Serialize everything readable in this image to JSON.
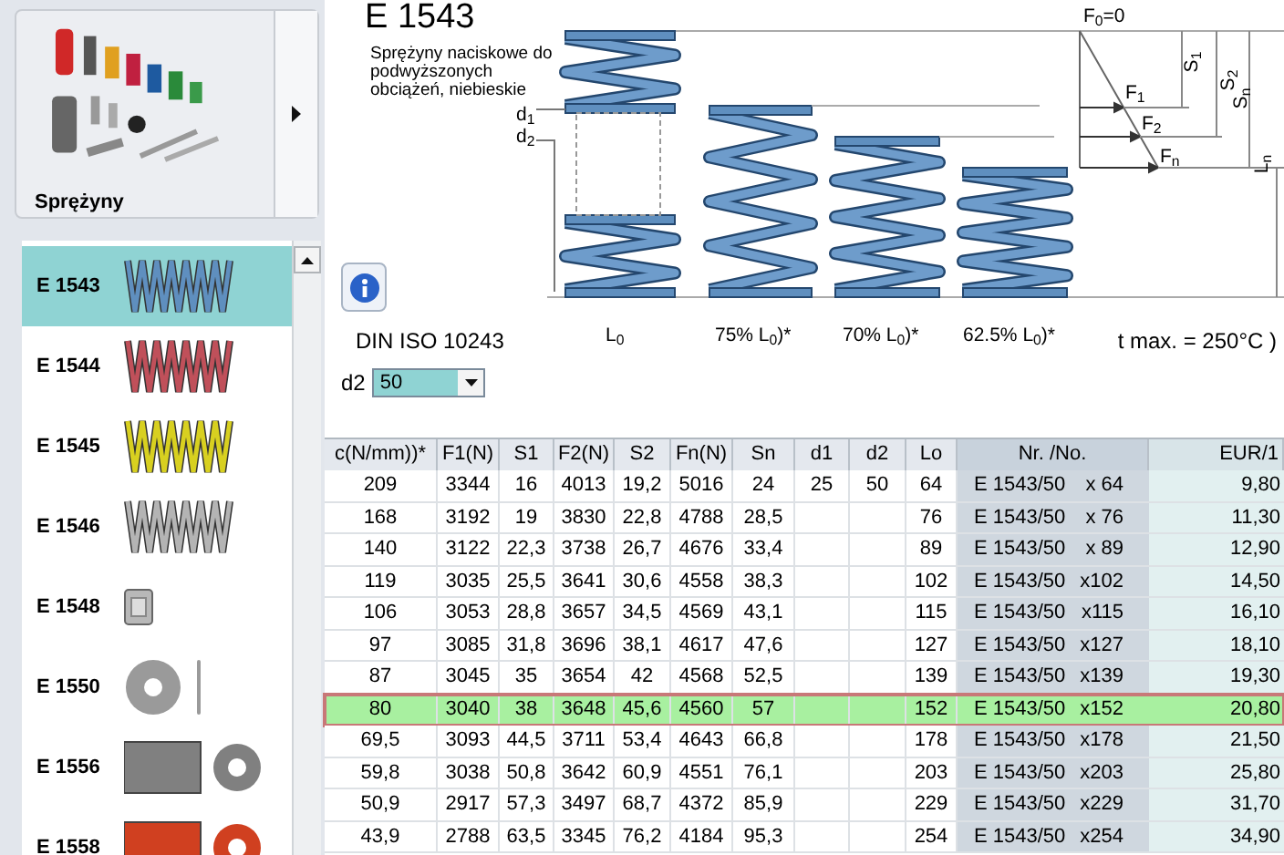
{
  "sidebar": {
    "category": {
      "label": "Sprężyny"
    },
    "items": [
      {
        "code": "E 1543",
        "kind": "spring",
        "color": "#5f8fbf",
        "selected": true
      },
      {
        "code": "E 1544",
        "kind": "spring",
        "color": "#c0505a",
        "selected": false
      },
      {
        "code": "E 1545",
        "kind": "spring",
        "color": "#d8d020",
        "selected": false
      },
      {
        "code": "E 1546",
        "kind": "spring",
        "color": "#b4b4b4",
        "selected": false
      },
      {
        "code": "E 1548",
        "kind": "cap",
        "color": "#b8b8b8",
        "selected": false
      },
      {
        "code": "E 1550",
        "kind": "washer",
        "color": "#9a9a9a",
        "selected": false
      },
      {
        "code": "E 1556",
        "kind": "sleeve",
        "color": "#808080",
        "selected": false
      },
      {
        "code": "E 1558",
        "kind": "sleeve",
        "color": "#d04020",
        "selected": false
      }
    ]
  },
  "product": {
    "title": "E 1543",
    "description": "Sprężyny naciskowe do podwyższonych obciążeń, niebieskie",
    "standard": "DIN ISO 10243",
    "temperature": "t max. = 250°C )"
  },
  "diagram": {
    "d1": "d$_{1}$",
    "d2": "d$_{2}$",
    "captions": [
      "L$_{0}$",
      "75% L$_{0}$)*",
      "70% L$_{0}$)*",
      "62.5% L$_{0}$)*"
    ],
    "forces": [
      "F$_{0}$=0",
      "F$_{1}$",
      "F$_{2}$",
      "F$_{n}$"
    ],
    "strokes": [
      "S$_{1}$",
      "S$_{2}$",
      "S$_{n}$",
      "L$_{n}$"
    ]
  },
  "filter": {
    "label": "d2",
    "value": "50"
  },
  "table": {
    "columns": [
      "c(N/mm))*",
      "F1(N)",
      "S1",
      "F2(N)",
      "S2",
      "Fn(N)",
      "Sn",
      "d1",
      "d2",
      "Lo",
      "Nr. /No.",
      "EUR/1"
    ],
    "rows": [
      {
        "cells": [
          "209",
          "3344",
          "16",
          "4013",
          "19,2",
          "5016",
          "24",
          "25",
          "50",
          "64"
        ],
        "number": "E 1543/50",
        "size": "x 64",
        "price": "9,80",
        "selected": false
      },
      {
        "cells": [
          "168",
          "3192",
          "19",
          "3830",
          "22,8",
          "4788",
          "28,5",
          null,
          null,
          "76"
        ],
        "number": "E 1543/50",
        "size": "x 76",
        "price": "11,30",
        "selected": false
      },
      {
        "cells": [
          "140",
          "3122",
          "22,3",
          "3738",
          "26,7",
          "4676",
          "33,4",
          null,
          null,
          "89"
        ],
        "number": "E 1543/50",
        "size": "x 89",
        "price": "12,90",
        "selected": false
      },
      {
        "cells": [
          "119",
          "3035",
          "25,5",
          "3641",
          "30,6",
          "4558",
          "38,3",
          null,
          null,
          "102"
        ],
        "number": "E 1543/50",
        "size": "x102",
        "price": "14,50",
        "selected": false
      },
      {
        "cells": [
          "106",
          "3053",
          "28,8",
          "3657",
          "34,5",
          "4569",
          "43,1",
          null,
          null,
          "115"
        ],
        "number": "E 1543/50",
        "size": "x115",
        "price": "16,10",
        "selected": false
      },
      {
        "cells": [
          "97",
          "3085",
          "31,8",
          "3696",
          "38,1",
          "4617",
          "47,6",
          null,
          null,
          "127"
        ],
        "number": "E 1543/50",
        "size": "x127",
        "price": "18,10",
        "selected": false
      },
      {
        "cells": [
          "87",
          "3045",
          "35",
          "3654",
          "42",
          "4568",
          "52,5",
          null,
          null,
          "139"
        ],
        "number": "E 1543/50",
        "size": "x139",
        "price": "19,30",
        "selected": false
      },
      {
        "cells": [
          "80",
          "3040",
          "38",
          "3648",
          "45,6",
          "4560",
          "57",
          null,
          null,
          "152"
        ],
        "number": "E 1543/50",
        "size": "x152",
        "price": "20,80",
        "selected": true
      },
      {
        "cells": [
          "69,5",
          "3093",
          "44,5",
          "3711",
          "53,4",
          "4643",
          "66,8",
          null,
          null,
          "178"
        ],
        "number": "E 1543/50",
        "size": "x178",
        "price": "21,50",
        "selected": false
      },
      {
        "cells": [
          "59,8",
          "3038",
          "50,8",
          "3642",
          "60,9",
          "4551",
          "76,1",
          null,
          null,
          "203"
        ],
        "number": "E 1543/50",
        "size": "x203",
        "price": "25,80",
        "selected": false
      },
      {
        "cells": [
          "50,9",
          "2917",
          "57,3",
          "3497",
          "68,7",
          "4372",
          "85,9",
          null,
          null,
          "229"
        ],
        "number": "E 1543/50",
        "size": "x229",
        "price": "31,70",
        "selected": false
      },
      {
        "cells": [
          "43,9",
          "2788",
          "63,5",
          "3345",
          "76,2",
          "4184",
          "95,3",
          null,
          null,
          "254"
        ],
        "number": "E 1543/50",
        "size": "x254",
        "price": "34,90",
        "selected": false
      }
    ]
  }
}
